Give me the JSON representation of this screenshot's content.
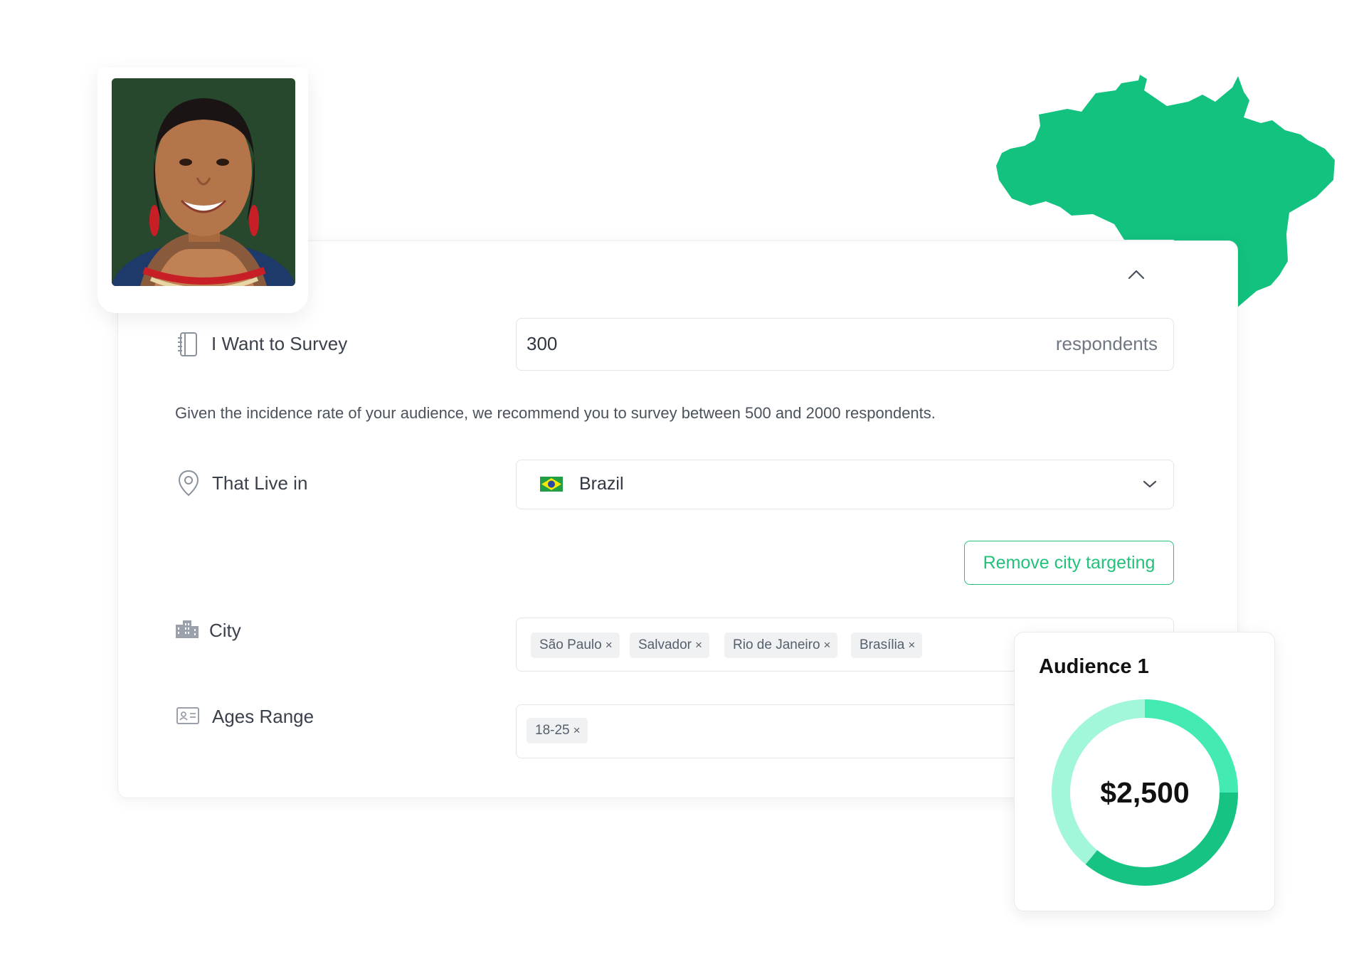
{
  "colors": {
    "accent": "#22c27a",
    "map_fill": "#13c27f",
    "donut_dark": "#17c383",
    "donut_mid": "#43ebb2",
    "donut_light": "#a2f6da"
  },
  "profile": {
    "photo_alt": "Survey respondent portrait"
  },
  "survey": {
    "quantity_label": "I Want to Survey",
    "quantity_value": "300",
    "quantity_unit": "respondents",
    "hint": "Given the incidence rate of your audience, we recommend you to survey between 500 and 2000 respondents.",
    "country_label": "That Live in",
    "country_value": "Brazil",
    "remove_city_label": "Remove city targeting",
    "city_label": "City",
    "cities": [
      "São Paulo",
      "Salvador",
      "Rio de Janeiro",
      "Brasília"
    ],
    "age_label": "Ages Range",
    "ages": [
      "18-25"
    ]
  },
  "tag_remove": "×",
  "audience": {
    "title": "Audience 1",
    "amount": "$2,500"
  },
  "icons": {
    "collapse": "chevron-up-icon",
    "quantity": "notebook-icon",
    "location": "map-pin-icon",
    "country_flag": "brazil-flag-icon",
    "dropdown": "chevron-down-icon",
    "city": "buildings-icon",
    "age": "id-card-icon",
    "map": "brazil-map-icon"
  }
}
